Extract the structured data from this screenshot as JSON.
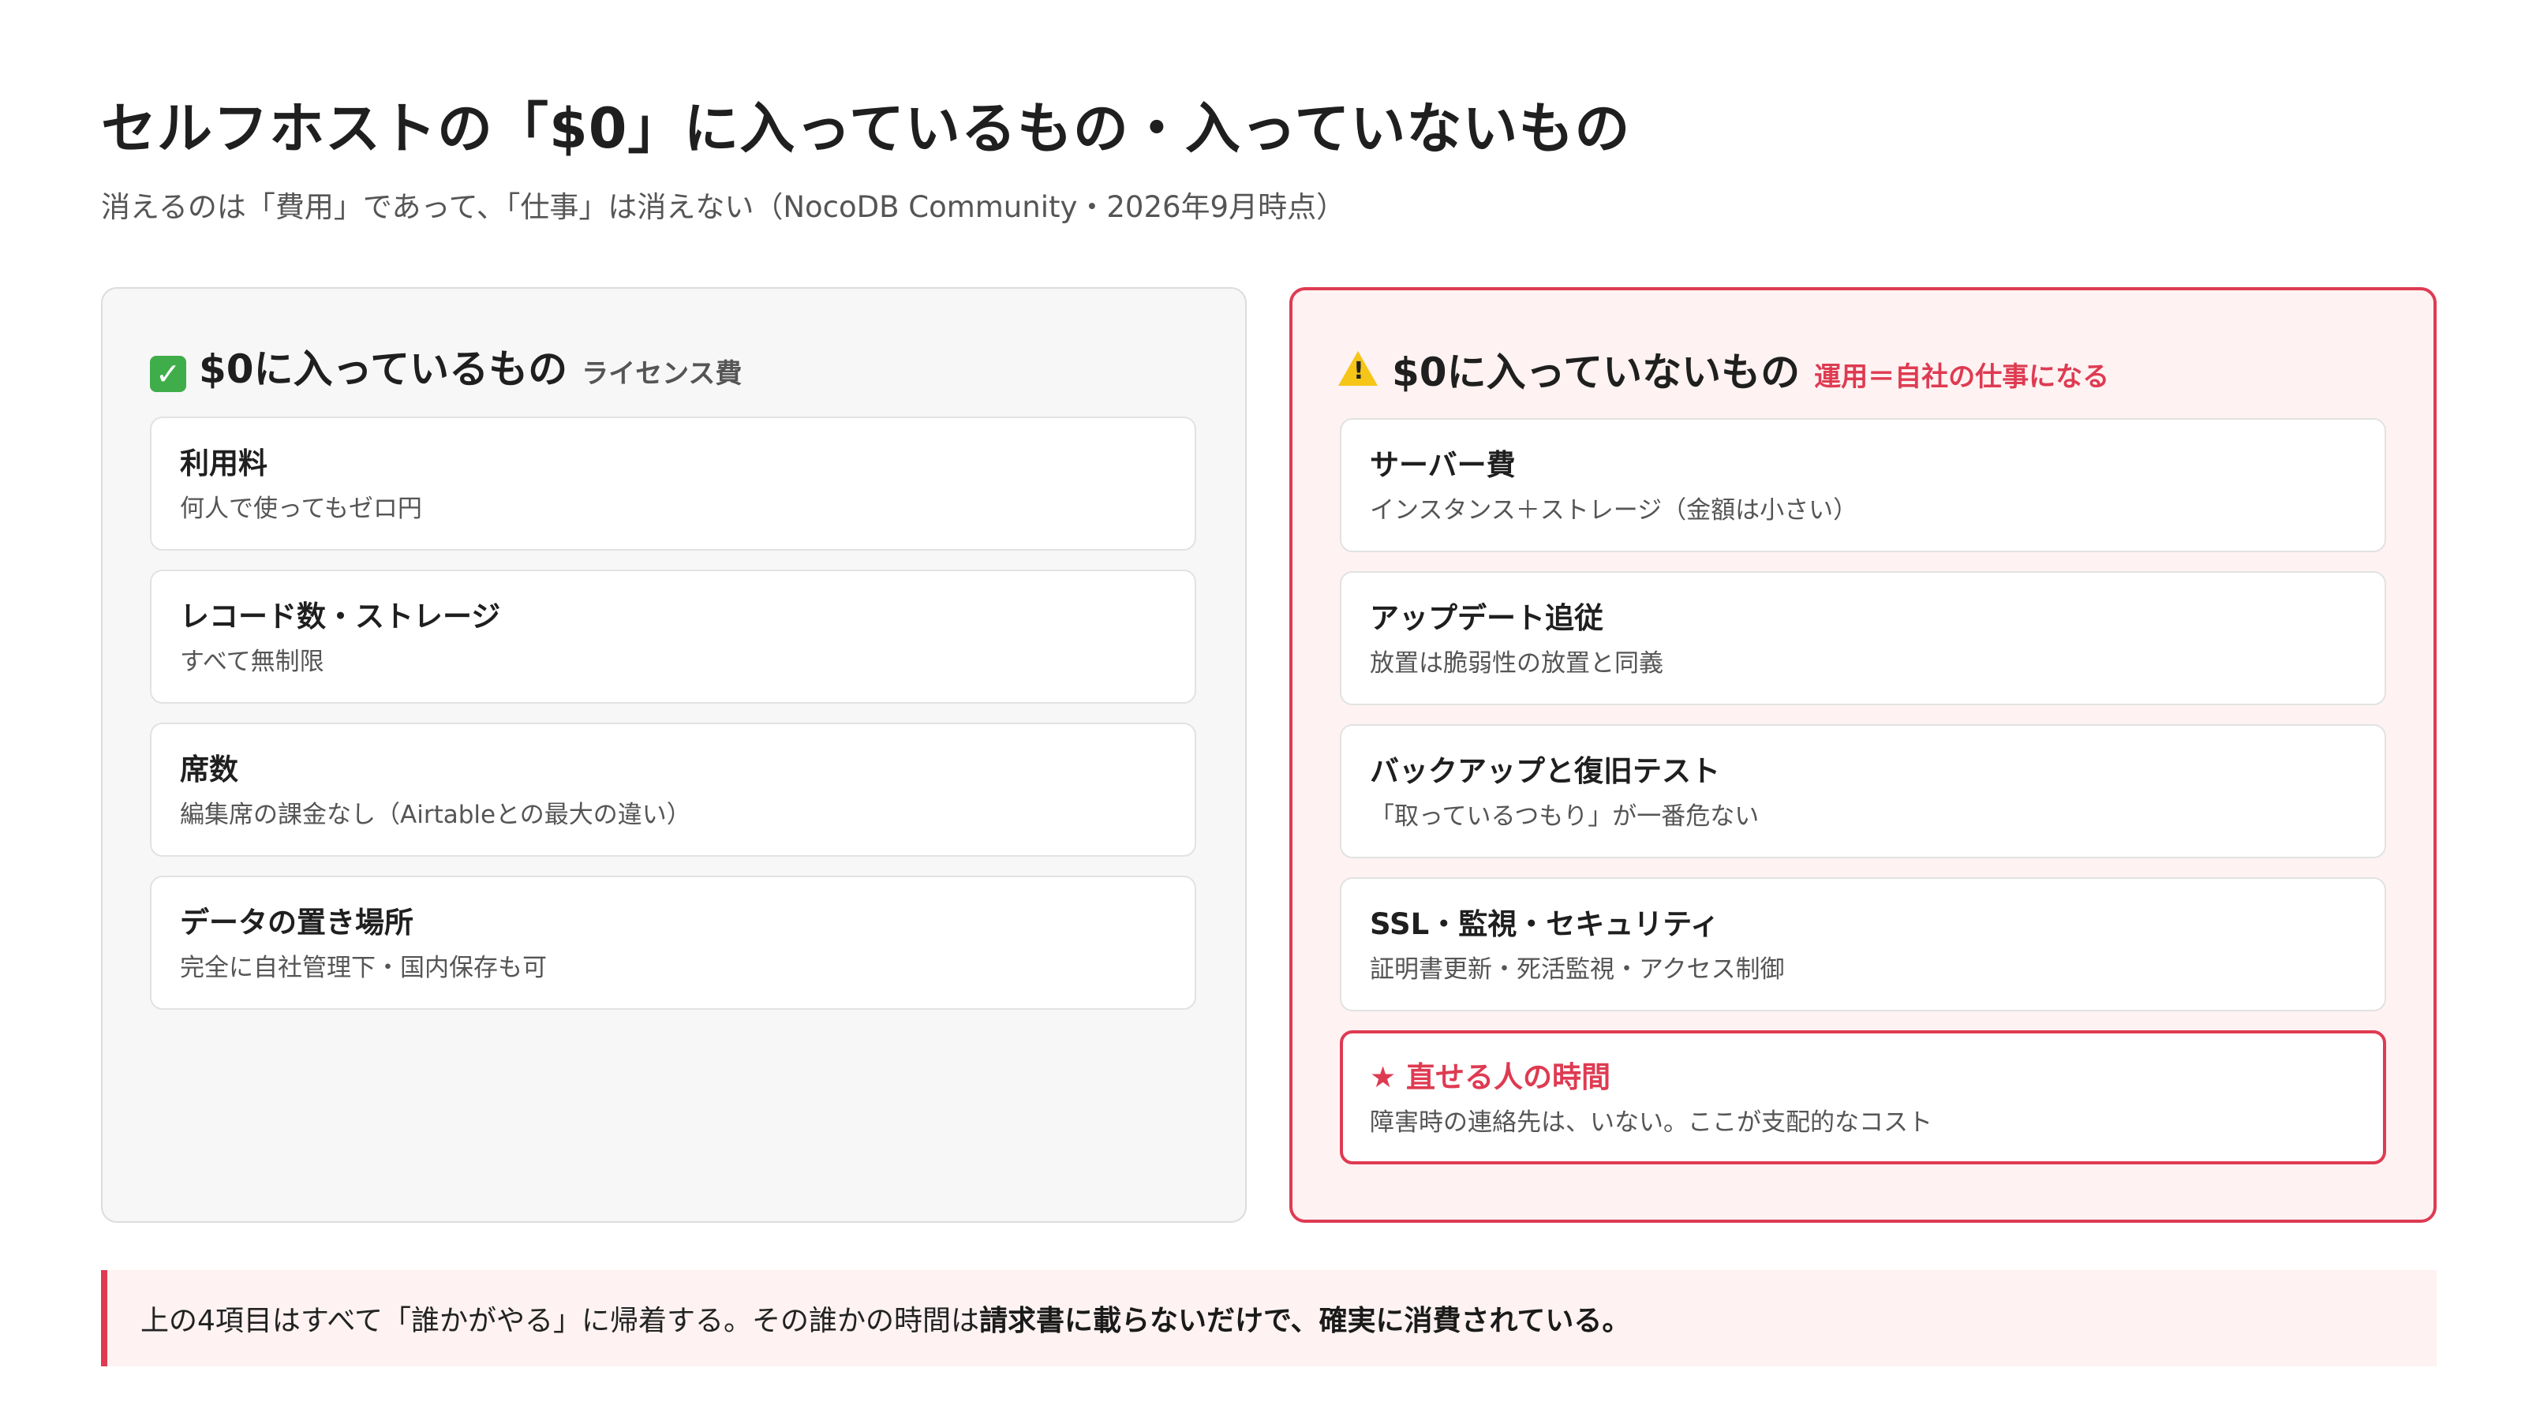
{
  "page": {
    "title": "セルフホストの「$0」に入っているもの・入っていないもの",
    "subtitle": "消えるのは「費用」であって、「仕事」は消えない（NocoDB Community・2026年9月時点）"
  },
  "included": {
    "icon": "check-mark-icon",
    "title": "$0に入っているもの",
    "tag": "ライセンス費",
    "items": [
      {
        "title": "利用料",
        "desc": "何人で使ってもゼロ円"
      },
      {
        "title": "レコード数・ストレージ",
        "desc": "すべて無制限"
      },
      {
        "title": "席数",
        "desc": "編集席の課金なし（Airtableとの最大の違い）"
      },
      {
        "title": "データの置き場所",
        "desc": "完全に自社管理下・国内保存も可"
      }
    ]
  },
  "excluded": {
    "icon": "warning-icon",
    "title": "$0に入っていないもの",
    "tag": "運用＝自社の仕事になる",
    "items": [
      {
        "title": "サーバー費",
        "desc": "インスタンス＋ストレージ（金額は小さい）"
      },
      {
        "title": "アップデート追従",
        "desc": "放置は脆弱性の放置と同義"
      },
      {
        "title": "バックアップと復旧テスト",
        "desc": "「取っているつもり」が一番危ない"
      },
      {
        "title": "SSL・監視・セキュリティ",
        "desc": "証明書更新・死活監視・アクセス制御"
      }
    ],
    "highlight": {
      "title": "★ 直せる人の時間",
      "desc": "障害時の連絡先は、いない。ここが支配的なコスト"
    }
  },
  "callout": {
    "prefix": "上の4項目はすべて「誰かがやる」に帰着する。その誰かの時間は",
    "emphasis": "請求書に載らないだけで、確実に消費されている。"
  },
  "colors": {
    "accent": "#de3b52",
    "accent_bg": "#fef2f2",
    "neutral_bg": "#f7f7f7",
    "check": "#3fae4a",
    "warning": "#f5c518"
  }
}
